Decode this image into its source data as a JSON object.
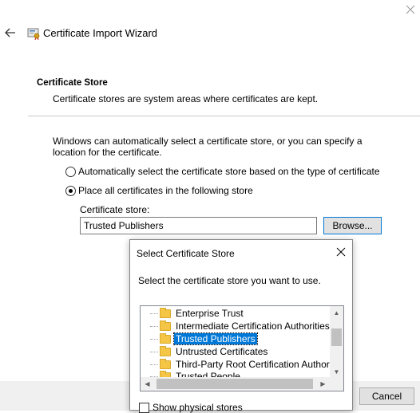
{
  "wizard": {
    "title": "Certificate Import Wizard",
    "section_title": "Certificate Store",
    "section_desc": "Certificate stores are system areas where certificates are kept.",
    "instructions": "Windows can automatically select a certificate store, or you can specify a location for the certificate.",
    "radio_auto": "Automatically select the certificate store based on the type of certificate",
    "radio_manual": "Place all certificates in the following store",
    "store_label": "Certificate store:",
    "store_value": "Trusted Publishers",
    "browse_label": "Browse...",
    "cancel_label": "Cancel"
  },
  "dialog": {
    "title": "Select Certificate Store",
    "instruction": "Select the certificate store you want to use.",
    "tree_items": [
      {
        "label": "Enterprise Trust",
        "selected": false
      },
      {
        "label": "Intermediate Certification Authorities",
        "selected": false
      },
      {
        "label": "Trusted Publishers",
        "selected": true
      },
      {
        "label": "Untrusted Certificates",
        "selected": false
      },
      {
        "label": "Third-Party Root Certification Authorities",
        "selected": false
      },
      {
        "label": "Trusted People",
        "selected": false
      }
    ],
    "show_physical_label": "Show physical stores",
    "show_physical_checked": false
  },
  "colors": {
    "selection": "#0078d7",
    "button_border_focus": "#0078d7"
  }
}
